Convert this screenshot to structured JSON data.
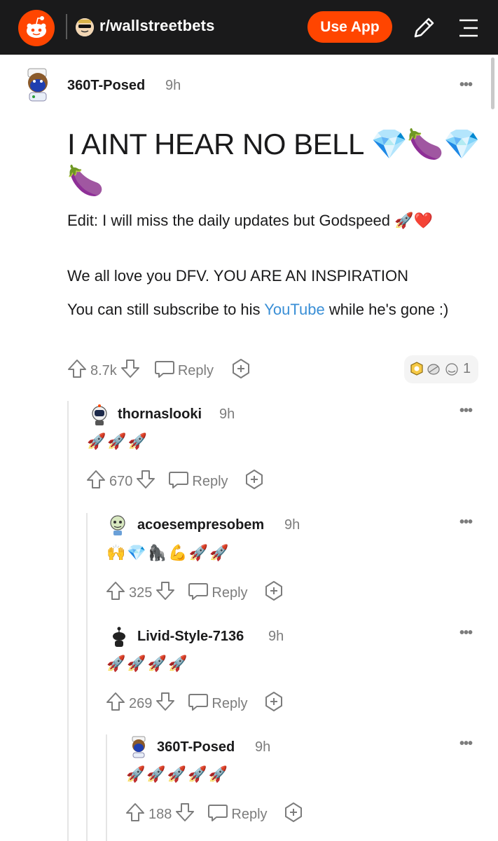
{
  "header": {
    "subreddit": "r/wallstreetbets",
    "use_app_label": "Use App"
  },
  "post": {
    "author": "360T-Posed",
    "time": "9h",
    "more": "•••",
    "title": "I AINT HEAR NO BELL 💎🍆💎🍆",
    "edit_line": "Edit: I will miss the daily updates but Godspeed 🚀❤️",
    "line2": "We all love you DFV. YOU ARE AN INSPIRATION",
    "line3_prefix": "You can still subscribe to his ",
    "line3_link": "YouTube",
    "line3_suffix": " while he's gone :)",
    "votes": "8.7k",
    "reply_label": "Reply",
    "award_count": "1"
  },
  "comments": [
    {
      "author": "thornaslooki",
      "time": "9h",
      "body": "🚀🚀🚀",
      "votes": "670",
      "reply_label": "Reply"
    },
    {
      "author": "acoesempresobem",
      "time": "9h",
      "body": "🙌💎🦍💪🚀🚀",
      "votes": "325",
      "reply_label": "Reply"
    },
    {
      "author": "Livid-Style-7136",
      "time": "9h",
      "body": "🚀🚀🚀🚀",
      "votes": "269",
      "reply_label": "Reply"
    },
    {
      "author": "360T-Posed",
      "time": "9h",
      "body": "🚀🚀🚀🚀🚀",
      "votes": "188",
      "reply_label": "Reply"
    }
  ],
  "colors": {
    "brand": "#ff4500",
    "header_bg": "#1a1a1b",
    "link": "#3a8fd6",
    "muted": "#7c7c7c"
  },
  "icons": [
    "reddit-logo-icon",
    "pencil-icon",
    "menu-icon",
    "upvote-icon",
    "downvote-icon",
    "reply-icon",
    "award-icon",
    "more-icon"
  ]
}
